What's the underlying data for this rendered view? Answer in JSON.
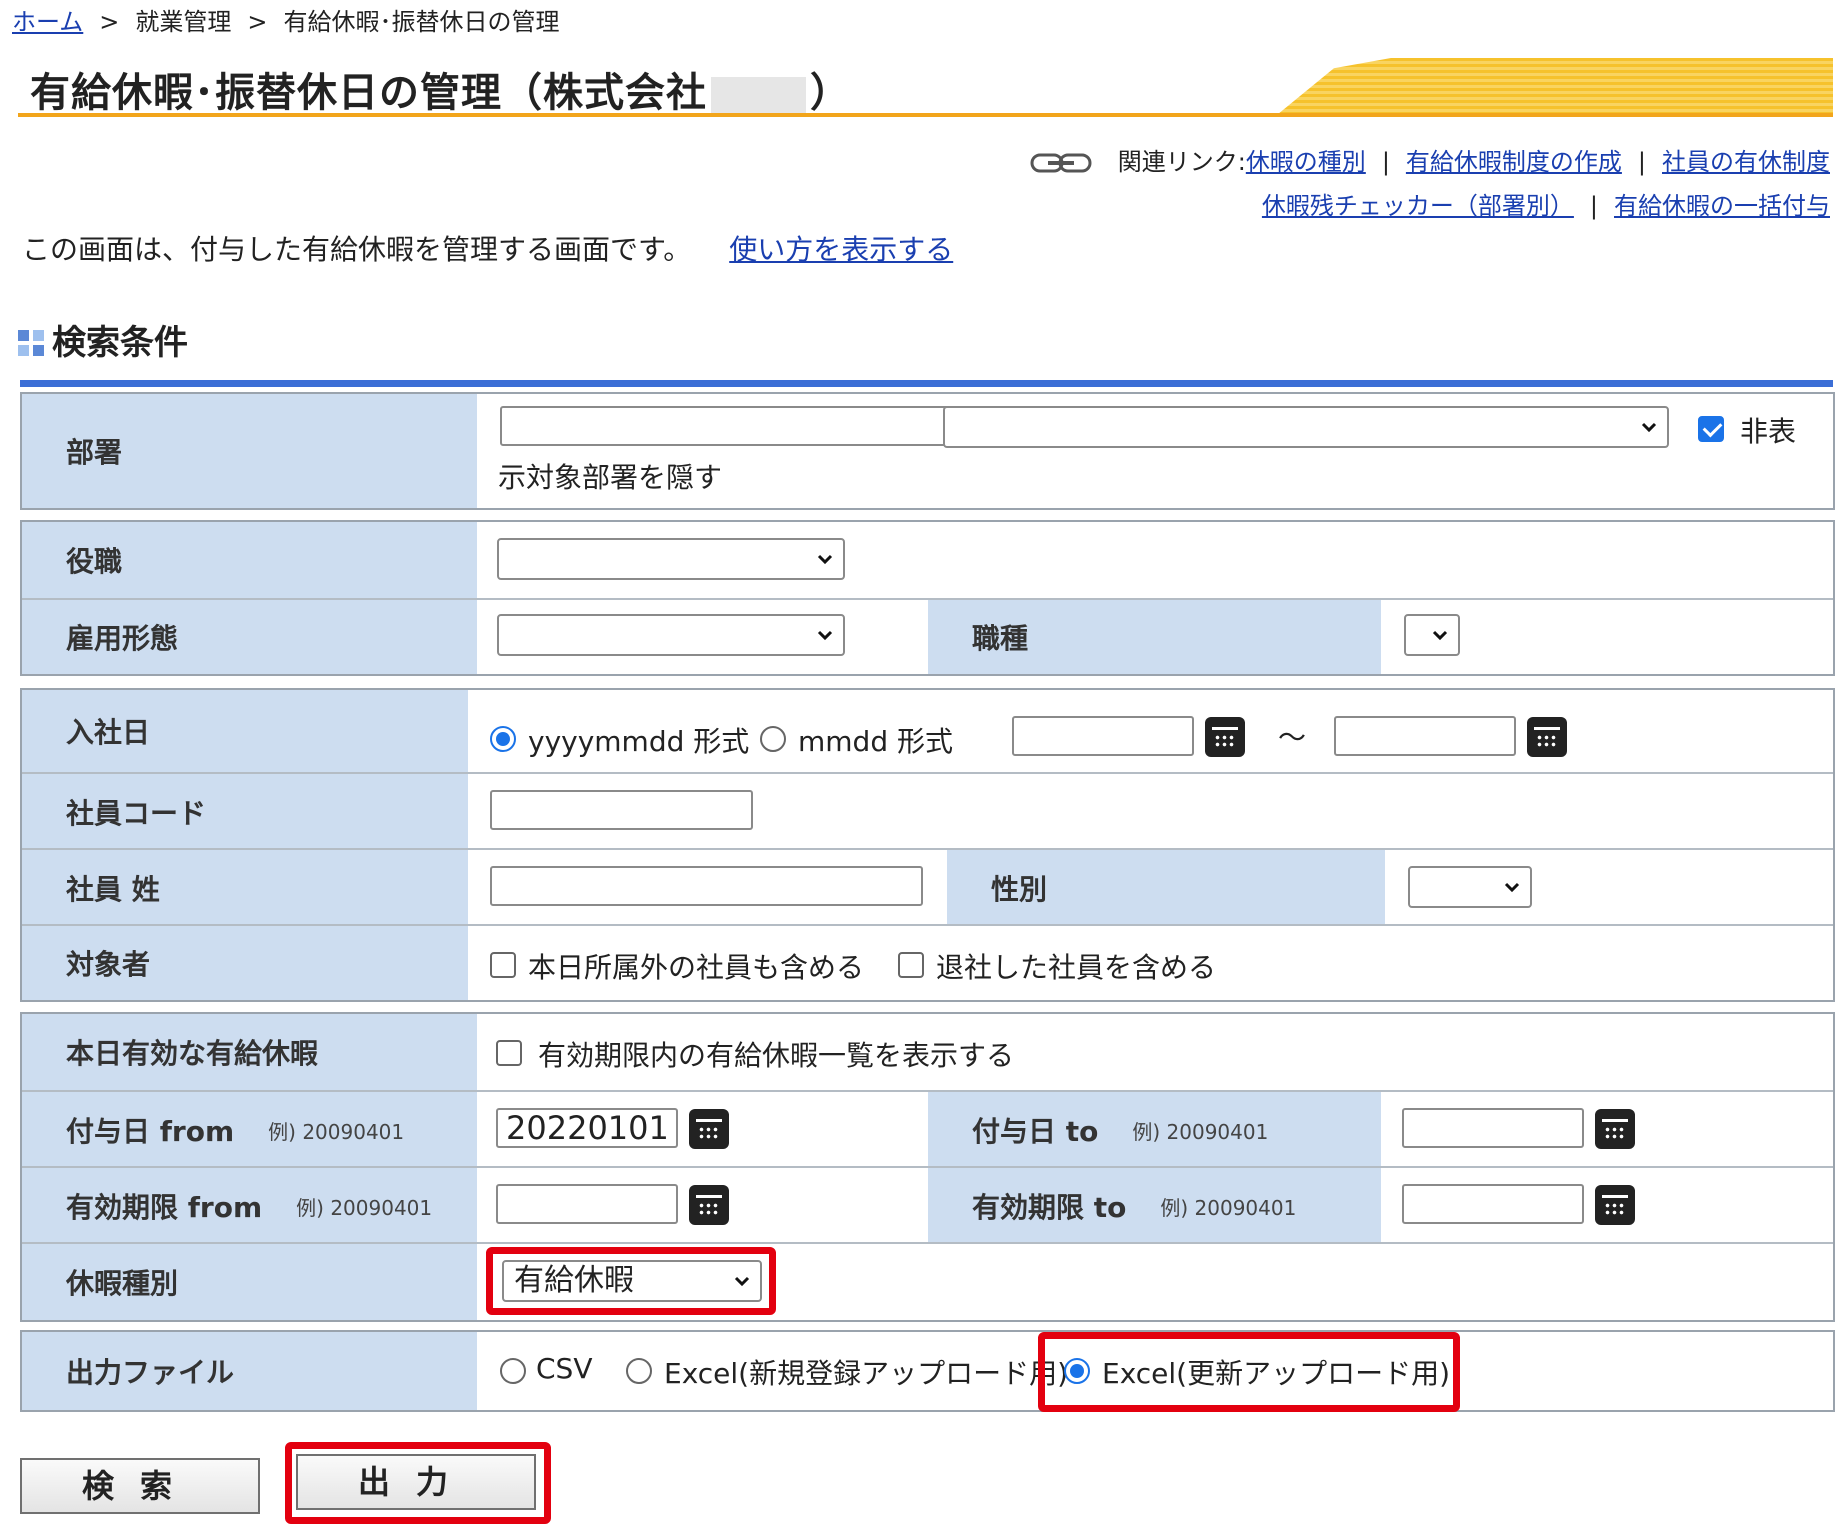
{
  "breadcrumb": {
    "home": "ホーム",
    "sep": ">",
    "level2": "就業管理",
    "level3": "有給休暇･振替休日の管理"
  },
  "title": {
    "prefix": "有給休暇･振替休日の管理（株式会社",
    "suffix": "）"
  },
  "related": {
    "label": "関連リンク:",
    "sep": "|",
    "link1": "休暇の種別",
    "link2": "有給休暇制度の作成",
    "link3": "社員の有休制度",
    "link4": "休暇残チェッカー（部署別）",
    "link5": "有給休暇の一括付与"
  },
  "intro": {
    "text": "この画面は、付与した有給休暇を管理する画面です。",
    "link": "使い方を表示する"
  },
  "section_title": "検索条件",
  "form": {
    "department": {
      "label": "部署",
      "hide_label_a": "非表",
      "hide_label_b": "示対象部署を隠す",
      "hide_checked": true
    },
    "position": {
      "label": "役職"
    },
    "employment_type": {
      "label": "雇用形態"
    },
    "job_type": {
      "label": "職種"
    },
    "hire_date": {
      "label": "入社日",
      "format1": "yyyymmdd 形式",
      "format2": "mmdd 形式",
      "tilde": "～"
    },
    "employee_code": {
      "label": "社員コード"
    },
    "employee_name": {
      "label": "社員 姓"
    },
    "gender": {
      "label": "性別"
    },
    "target": {
      "label": "対象者",
      "option1": "本日所属外の社員も含める",
      "option2": "退社した社員を含める"
    },
    "valid_today": {
      "label": "本日有効な有給休暇",
      "option": "有効期限内の有給休暇一覧を表示する"
    },
    "grant_from": {
      "label": "付与日 from",
      "example": "例) 20090401",
      "value": "20220101"
    },
    "grant_to": {
      "label": "付与日 to",
      "example": "例) 20090401",
      "value": ""
    },
    "expiry_from": {
      "label": "有効期限 from",
      "example": "例) 20090401",
      "value": ""
    },
    "expiry_to": {
      "label": "有効期限 to",
      "example": "例) 20090401",
      "value": ""
    },
    "leave_type": {
      "label": "休暇種別",
      "selected": "有給休暇"
    },
    "output_file": {
      "label": "出力ファイル",
      "option1": "CSV",
      "option2": "Excel(新規登録アップロード用)",
      "option3": "Excel(更新アップロード用)",
      "selected": "option3"
    }
  },
  "buttons": {
    "search": "検索",
    "output": "出力"
  },
  "colors": {
    "accent_red": "#e3000f",
    "label_bg": "#cdddf0",
    "link": "#1a3fb0",
    "title_orange": "#f2a51b"
  },
  "icons": {
    "calendar": "calendar-icon",
    "chevron": "chevron-down-icon",
    "link": "chain-link-icon"
  }
}
